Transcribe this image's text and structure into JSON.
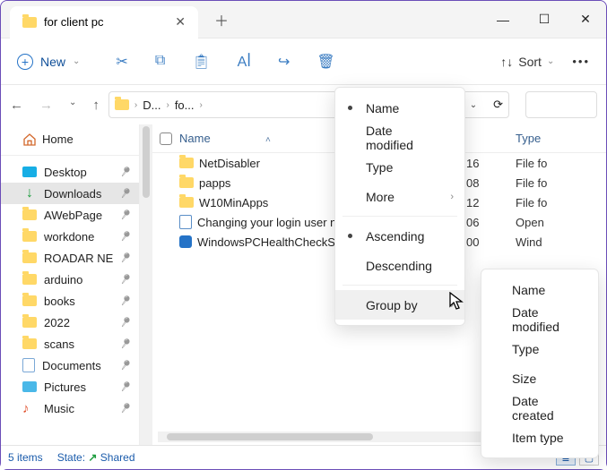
{
  "window": {
    "tab_title": "for client pc",
    "new_label": "New",
    "sort_label": "Sort"
  },
  "breadcrumb": {
    "p1": "D...",
    "p2": "fo..."
  },
  "sidebar": {
    "home": "Home",
    "items": [
      {
        "label": "Desktop",
        "icon": "desktop"
      },
      {
        "label": "Downloads",
        "icon": "download",
        "selected": true
      },
      {
        "label": "AWebPage",
        "icon": "folder"
      },
      {
        "label": "workdone",
        "icon": "folder"
      },
      {
        "label": "ROADAR NE",
        "icon": "folder"
      },
      {
        "label": "arduino",
        "icon": "folder"
      },
      {
        "label": "books",
        "icon": "folder"
      },
      {
        "label": "2022",
        "icon": "folder"
      },
      {
        "label": "scans",
        "icon": "folder"
      },
      {
        "label": "Documents",
        "icon": "doc"
      },
      {
        "label": "Pictures",
        "icon": "pic"
      },
      {
        "label": "Music",
        "icon": "music"
      }
    ]
  },
  "columns": {
    "name": "Name",
    "type": "Type"
  },
  "files": [
    {
      "name": "NetDisabler",
      "date": "16",
      "type": "File fo",
      "icon": "folder"
    },
    {
      "name": "papps",
      "date": "08",
      "type": "File fo",
      "icon": "folder"
    },
    {
      "name": "W10MinApps",
      "date": "12",
      "type": "File fo",
      "icon": "folder"
    },
    {
      "name": "Changing your login user na",
      "date": "06",
      "type": "Open",
      "icon": "doc"
    },
    {
      "name": "WindowsPCHealthCheckSetu",
      "date": "00",
      "type": "Wind",
      "icon": "exe"
    }
  ],
  "sortmenu": {
    "name": "Name",
    "datemod": "Date modified",
    "type": "Type",
    "more": "More",
    "asc": "Ascending",
    "desc": "Descending",
    "groupby": "Group by"
  },
  "groupby": {
    "name": "Name",
    "datemod": "Date modified",
    "type": "Type",
    "size": "Size",
    "datecr": "Date created",
    "itemtype": "Item type"
  },
  "status": {
    "count": "5 items",
    "state_label": "State:",
    "shared": "Shared"
  }
}
